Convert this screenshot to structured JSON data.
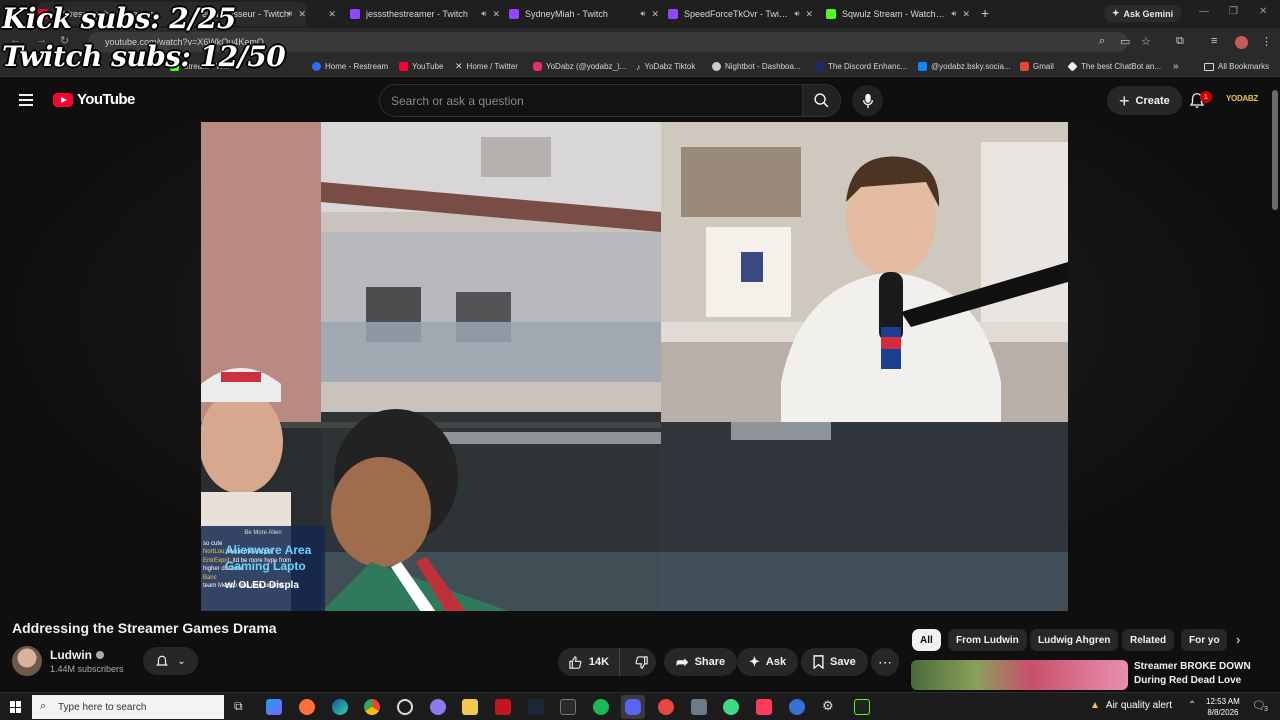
{
  "overlay": {
    "kick": "Kick subs: 2/25",
    "twitch": "Twitch subs: 12/50"
  },
  "browser": {
    "tabs": [
      {
        "title": "Addressing the Streamer...",
        "favicon_color": "#ff0033"
      },
      {
        "title": "elcannasseur - Twitch",
        "favicon_color": "#9146ff"
      },
      {
        "title": "jesssthestreamer - Twitch",
        "favicon_color": "#9146ff"
      },
      {
        "title": "SydneyMiah - Twitch",
        "favicon_color": "#9146ff"
      },
      {
        "title": "SpeedForceTkOvr - Twitch",
        "favicon_color": "#9146ff"
      },
      {
        "title": "Sqwulz Stream - Watch Live",
        "favicon_color": "#53fc18"
      }
    ],
    "ask_gemini": "Ask Gemini",
    "url": "youtube.com/watch?v=X6WkOu4KemQ",
    "bookmarks": [
      {
        "label": "Stream - W...",
        "color": "#53fc18"
      },
      {
        "label": "Home - Restream",
        "color": "#2f6bff"
      },
      {
        "label": "YouTube",
        "color": "#ff0033"
      },
      {
        "label": "Home / Twitter",
        "color": "#ffffff"
      },
      {
        "label": "YoDabz (@yodabz_)...",
        "color": "#e1306c"
      },
      {
        "label": "YoDabz Tiktok",
        "color": "#111111"
      },
      {
        "label": "Nightbot - Dashboa...",
        "color": "#cccccc"
      },
      {
        "label": "The Discord Enhanc...",
        "color": "#1c2a70"
      },
      {
        "label": "@yodabz.bsky.socia...",
        "color": "#1185fe"
      },
      {
        "label": "Gmail",
        "color": "#ea4335"
      },
      {
        "label": "The best ChatBot an...",
        "color": "#eeeeee"
      }
    ],
    "all_bookmarks": "All Bookmarks"
  },
  "youtube": {
    "logo_text": "YouTube",
    "search_placeholder": "Search or ask a question",
    "create_label": "Create",
    "notification_count": "1",
    "account_label": "YODABZ"
  },
  "video_overlay": {
    "chat_header": "Be More Alien",
    "ad_line1": "Alienware Area",
    "ad_line2": "Gaming Lapto",
    "ad_line3": "w/ OLED Displa",
    "messages": [
      {
        "user": "",
        "text": "so cute"
      },
      {
        "user": "NortLou:",
        "text": "bleue messaquer"
      },
      {
        "user": "EntrExprit:",
        "text": "itd be more hype from"
      },
      {
        "user": "",
        "text": "higher distance"
      },
      {
        "user": "Banc",
        "text": ""
      },
      {
        "user": "",
        "text": "team Mexico was also cinema"
      }
    ]
  },
  "video": {
    "title": "Addressing the Streamer Games Drama",
    "channel": "Ludwin",
    "subscribers": "1.44M subscribers",
    "likes": "14K",
    "share": "Share",
    "ask": "Ask",
    "save": "Save"
  },
  "chips": [
    "All",
    "From Ludwin",
    "Ludwig Ahgren",
    "Related",
    "For yo"
  ],
  "related": {
    "title": "Streamer BROKE DOWN During Red Dead Love"
  },
  "taskbar": {
    "search_placeholder": "Type here to search",
    "air_quality": "Air quality alert",
    "time": "12:53 AM",
    "date": "8/8/2026",
    "notif_count": "3"
  }
}
